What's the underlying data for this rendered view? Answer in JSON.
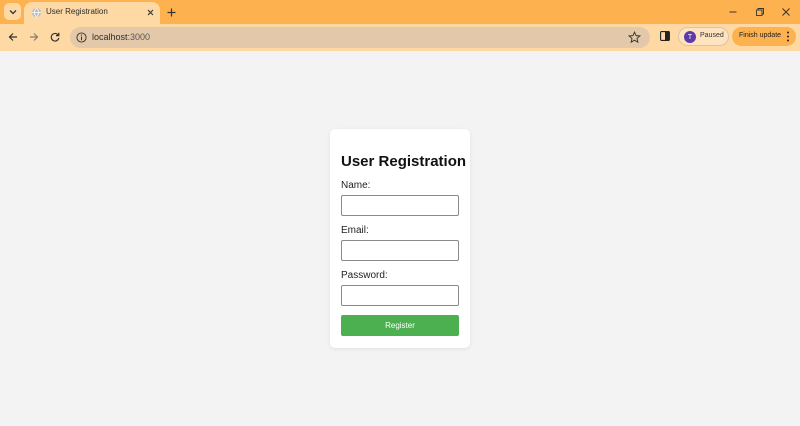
{
  "browser": {
    "tab": {
      "title": "User Registration"
    },
    "address": {
      "host": "localhost",
      "port": ":3000"
    },
    "profile": {
      "initial": "T",
      "status": "Paused"
    },
    "update_label": "Finish update"
  },
  "form": {
    "title": "User Registration",
    "fields": [
      {
        "label": "Name:",
        "value": ""
      },
      {
        "label": "Email:",
        "value": ""
      },
      {
        "label": "Password:",
        "value": ""
      }
    ],
    "submit_label": "Register"
  },
  "colors": {
    "chrome_frame": "#fdb24f",
    "chrome_toolbar": "#fed9a4",
    "page_background": "#f3f3f3",
    "submit_button": "#4caf50",
    "avatar": "#5e3aa8"
  },
  "icons": [
    "tab-search-icon",
    "globe-icon",
    "close-icon",
    "plus-icon",
    "minimize-icon",
    "restore-icon",
    "back-arrow-icon",
    "forward-arrow-icon",
    "reload-icon",
    "info-icon",
    "star-icon",
    "side-panel-icon",
    "kebab-menu-icon"
  ]
}
